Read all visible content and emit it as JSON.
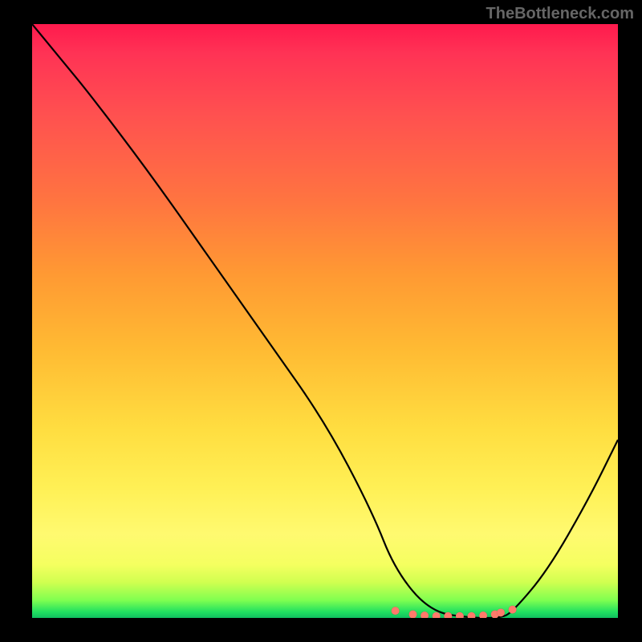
{
  "watermark": "TheBottleneck.com",
  "chart_data": {
    "type": "line",
    "title": "",
    "xlabel": "",
    "ylabel": "",
    "xlim": [
      0,
      100
    ],
    "ylim": [
      0,
      100
    ],
    "series": [
      {
        "name": "bottleneck-curve",
        "x": [
          0,
          5,
          10,
          20,
          30,
          40,
          50,
          58,
          62,
          68,
          75,
          80,
          82,
          88,
          95,
          100
        ],
        "y": [
          100,
          94,
          88,
          75,
          61,
          47,
          33,
          18,
          8,
          1,
          0,
          0,
          1,
          8,
          20,
          30
        ]
      }
    ],
    "markers": {
      "name": "highlight-points",
      "color": "#ff7a6b",
      "x": [
        62,
        65,
        67,
        69,
        71,
        73,
        75,
        77,
        79,
        80,
        82
      ],
      "y": [
        1.2,
        0.6,
        0.4,
        0.3,
        0.3,
        0.3,
        0.3,
        0.4,
        0.6,
        0.9,
        1.4
      ]
    },
    "gradient_stops": [
      {
        "pos": 0,
        "color": "#ff1a4d"
      },
      {
        "pos": 15,
        "color": "#ff5050"
      },
      {
        "pos": 42,
        "color": "#ff9933"
      },
      {
        "pos": 68,
        "color": "#ffdd40"
      },
      {
        "pos": 86,
        "color": "#fffa70"
      },
      {
        "pos": 97,
        "color": "#80ff50"
      },
      {
        "pos": 100,
        "color": "#10c060"
      }
    ]
  }
}
